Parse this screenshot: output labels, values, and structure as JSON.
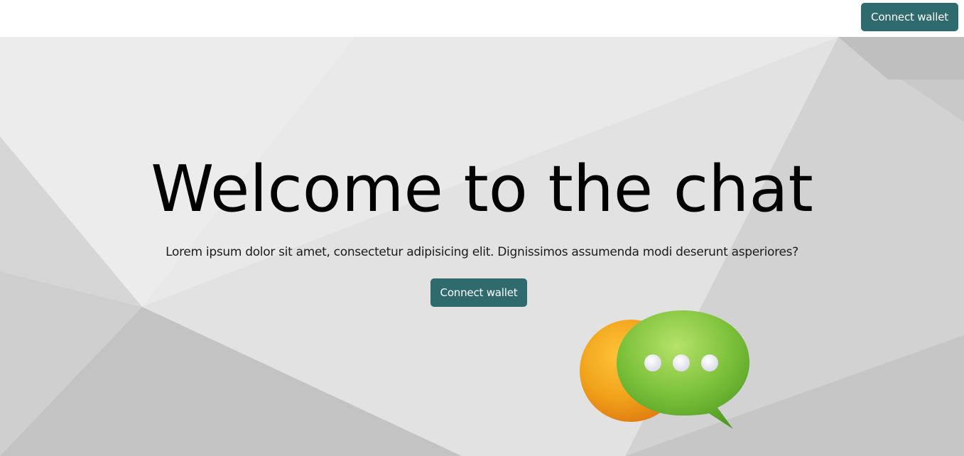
{
  "header": {
    "connect_label": "Connect wallet"
  },
  "hero": {
    "title": "Welcome to the chat",
    "subtitle": "Lorem ipsum dolor sit amet, consectetur adipisicing elit. Dignissimos assumenda modi deserunt asperiores?",
    "connect_label": "Connect wallet"
  },
  "colors": {
    "accent": "#2f6b6e",
    "bubble_back": "#f0a21a",
    "bubble_front": "#7cc13a"
  },
  "illustration": {
    "icon": "chat-bubbles-icon"
  }
}
